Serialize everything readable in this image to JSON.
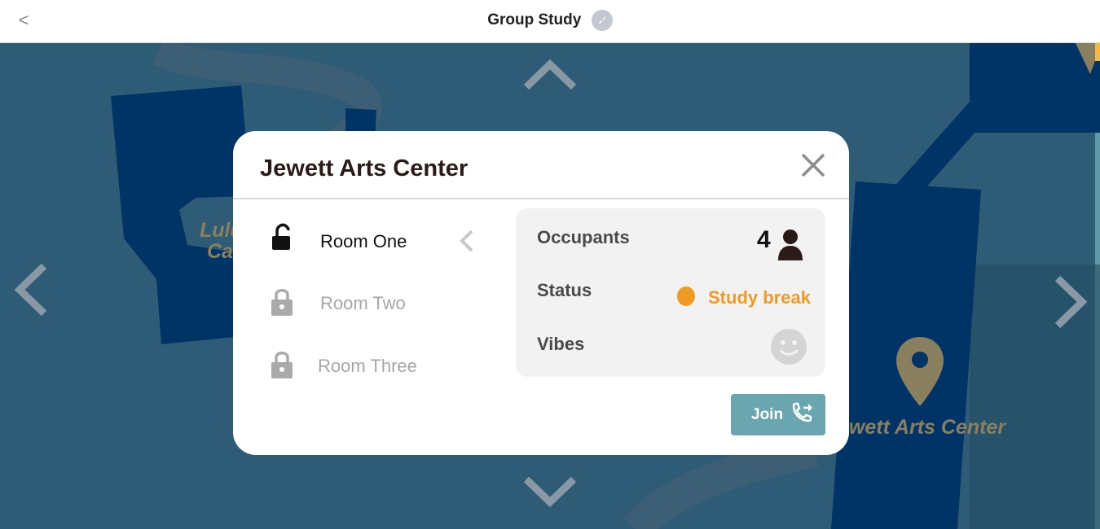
{
  "header": {
    "back_label": "<",
    "title": "Group Study",
    "compass_icon": "compass-icon"
  },
  "map": {
    "labels": {
      "left_building_line1": "Lulu",
      "left_building_line2": "Ca",
      "right_building": "ewett Arts Center"
    }
  },
  "modal": {
    "title": "Jewett Arts Center",
    "rooms": [
      {
        "name": "Room One",
        "locked": false,
        "selected": true
      },
      {
        "name": "Room Two",
        "locked": true,
        "selected": false
      },
      {
        "name": "Room Three",
        "locked": true,
        "selected": false
      }
    ],
    "info": {
      "occupants_label": "Occupants",
      "occupants_count": "4",
      "status_label": "Status",
      "status_value": "Study break",
      "status_color": "#ef9a22",
      "vibes_label": "Vibes",
      "vibes_icon": "smiley-face-icon"
    },
    "join_label": "Join"
  },
  "colors": {
    "map_water": "#2e5c76",
    "building": "#003366",
    "accent": "#6aa6b0",
    "pin": "#8a7f5e"
  }
}
